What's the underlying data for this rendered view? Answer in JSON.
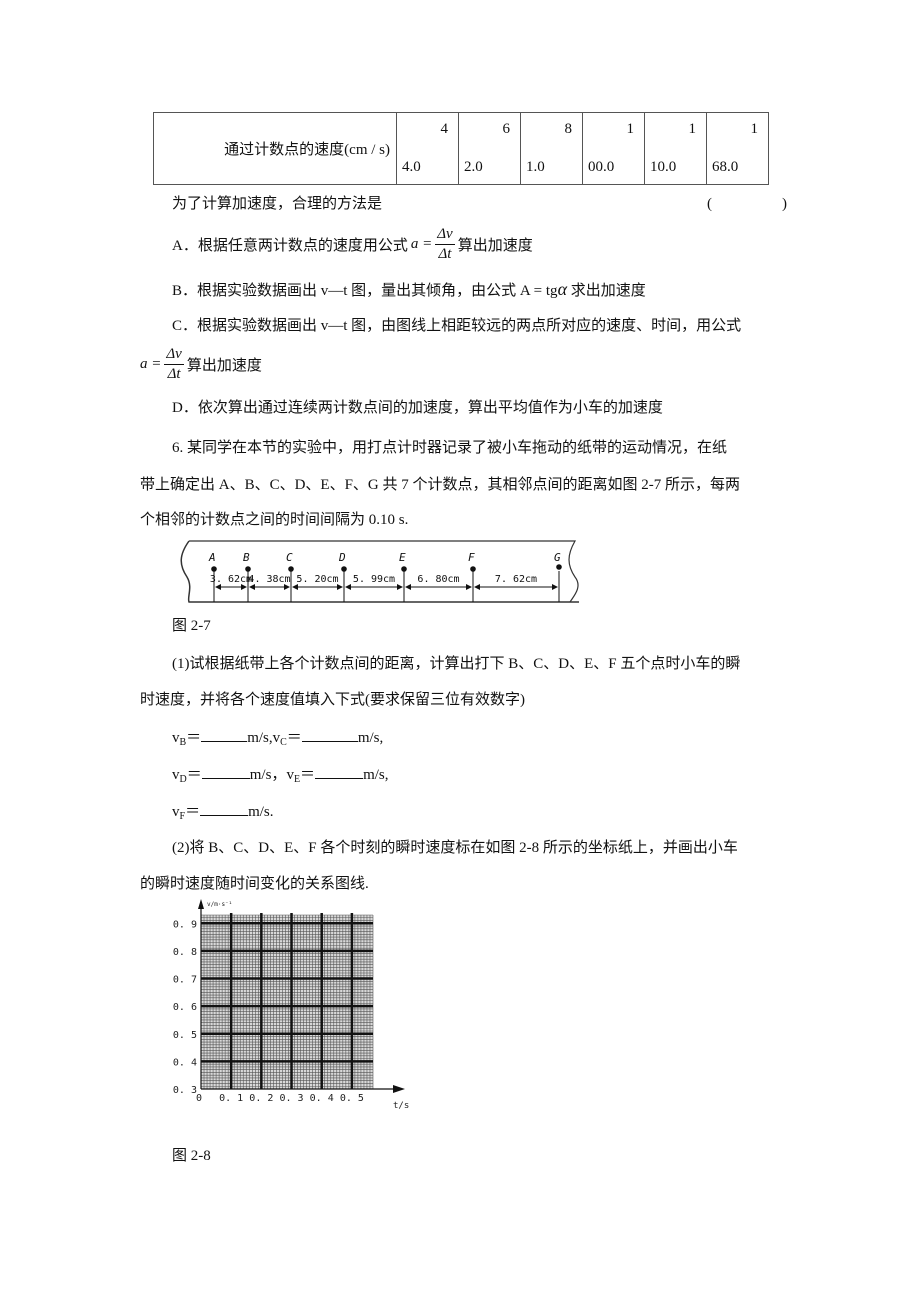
{
  "table": {
    "row_label": "通过计数点的速度(cm / s)",
    "cells": [
      {
        "top": "4",
        "bottom": "4.0"
      },
      {
        "top": "6",
        "bottom": "2.0"
      },
      {
        "top": "8",
        "bottom": "1.0"
      },
      {
        "top": "1",
        "bottom": "00.0"
      },
      {
        "top": "1",
        "bottom": "10.0"
      },
      {
        "top": "1",
        "bottom": "68.0"
      }
    ]
  },
  "question5": {
    "stem": "为了计算加速度，合理的方法是",
    "answer_bracket_open": "(",
    "answer_bracket_close": ")",
    "options": {
      "A_pre": "A．根据任意两计数点的速度用公式",
      "A_post": "算出加速度",
      "B": "B．根据实验数据画出 v—t 图，量出其倾角，由公式 A = tg",
      "B_alpha": "α",
      "B_post": "求出加速度",
      "C_line1": "C．根据实验数据画出 v—t 图，由图线上相距较远的两点所对应的速度、时间，用公式",
      "C_post": "算出加速度",
      "D": "D．依次算出通过连续两计数点间的加速度，算出平均值作为小车的加速度"
    },
    "formula": {
      "lhs": "a =",
      "num": "Δv",
      "den": "Δt"
    }
  },
  "question6": {
    "line1": "6. 某同学在本节的实验中，用打点计时器记录了被小车拖动的纸带的运动情况，在纸",
    "line2": "带上确定出 A、B、C、D、E、F、G 共 7 个计数点，其相邻点间的距离如图 2-7 所示，每两",
    "line3": "个相邻的计数点之间的时间间隔为 0.10 s.",
    "fig27_caption": "图 2-7",
    "part1_line1": "(1)试根据纸带上各个计数点间的距离，计算出打下 B、C、D、E、F 五个点时小车的瞬",
    "part1_line2": "时速度，并将各个速度值填入下式(要求保留三位有效数字)",
    "answers": {
      "vB": "v",
      "vB_sub": "B",
      "vC_sub": "C",
      "vD_sub": "D",
      "vE_sub": "E",
      "vF_sub": "F",
      "eq": "＝",
      "unit": "m/s,",
      "unit_comma": "m/s，",
      "unit_end": "m/s.",
      "sep": "m/s,v"
    },
    "part2_line1": "(2)将 B、C、D、E、F 各个时刻的瞬时速度标在如图 2-8 所示的坐标纸上，并画出小车",
    "part2_line2": "的瞬时速度随时间变化的关系图线.",
    "fig28_caption": "图 2-8"
  },
  "tape": {
    "points": [
      "A",
      "B",
      "C",
      "D",
      "E",
      "F",
      "G"
    ],
    "distances": [
      "3.62cm",
      "4.38cm",
      "5.20cm",
      "5.99cm",
      "6.80cm",
      "7.62cm"
    ]
  },
  "chart_data": {
    "type": "scatter",
    "title": "",
    "xlabel": "t/s",
    "ylabel": "v/m·s⁻¹",
    "xlim": [
      0,
      0.57
    ],
    "ylim": [
      0.3,
      0.93
    ],
    "x_ticks": [
      "0",
      "0.1",
      "0.2",
      "0.3",
      "0.4",
      "0.5"
    ],
    "y_ticks": [
      "0.3",
      "0.4",
      "0.5",
      "0.6",
      "0.7",
      "0.8",
      "0.9"
    ],
    "grid": true,
    "series": []
  }
}
